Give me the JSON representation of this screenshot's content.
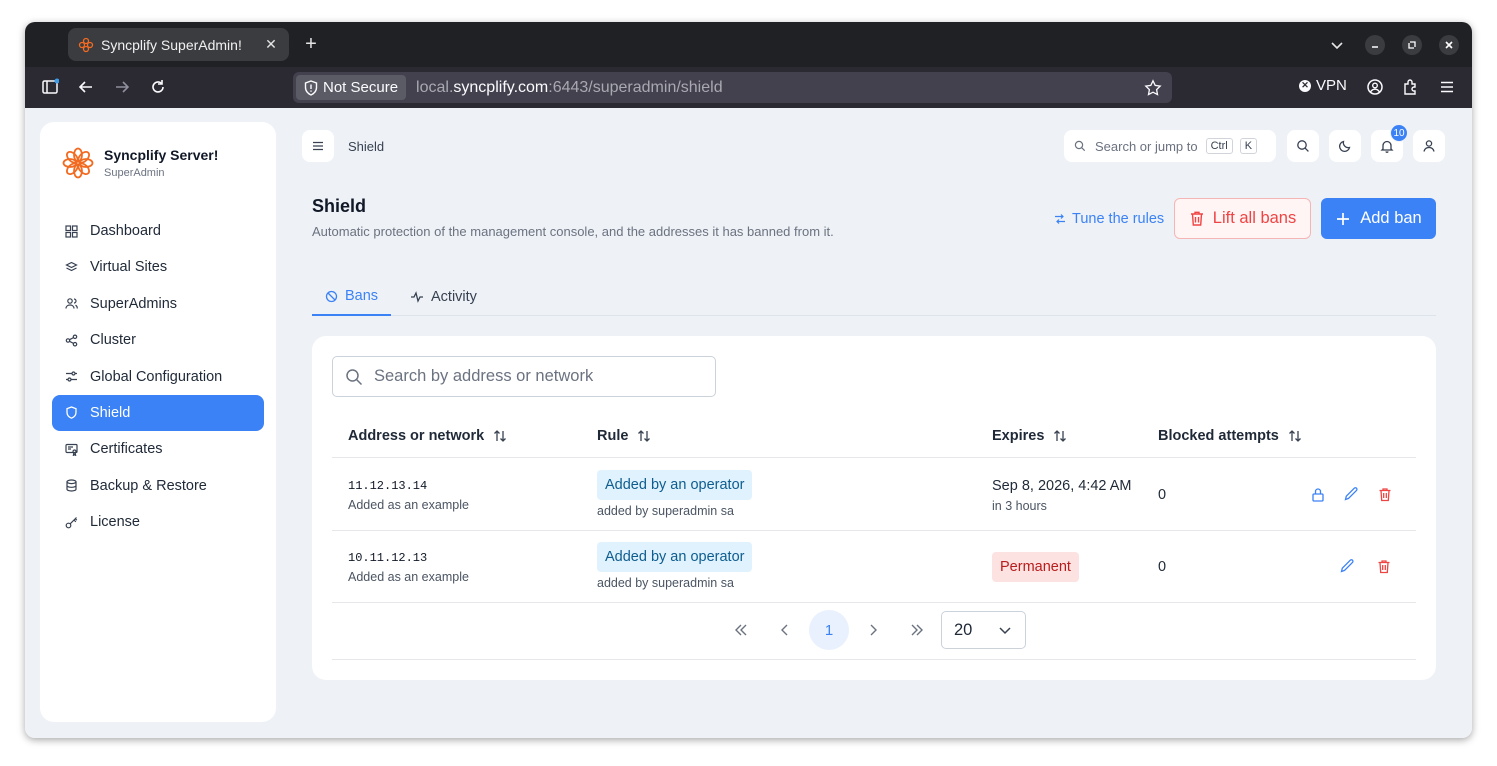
{
  "browser": {
    "tab_title": "Syncplify SuperAdmin!",
    "not_secure_label": "Not Secure",
    "url_prefix": "local.",
    "url_host": "syncplify.com",
    "url_rest": ":6443/superadmin/shield",
    "vpn_label": "VPN"
  },
  "sidebar": {
    "brand_name": "Syncplify Server!",
    "brand_sub": "SuperAdmin",
    "items": [
      {
        "label": "Dashboard",
        "icon": "grid-icon"
      },
      {
        "label": "Virtual Sites",
        "icon": "layers-icon"
      },
      {
        "label": "SuperAdmins",
        "icon": "users-icon"
      },
      {
        "label": "Cluster",
        "icon": "share-icon"
      },
      {
        "label": "Global Configuration",
        "icon": "sliders-icon"
      },
      {
        "label": "Shield",
        "icon": "shield-icon"
      },
      {
        "label": "Certificates",
        "icon": "certificate-icon"
      },
      {
        "label": "Backup & Restore",
        "icon": "database-icon"
      },
      {
        "label": "License",
        "icon": "key-icon"
      }
    ],
    "active": "Shield"
  },
  "header": {
    "breadcrumb": "Shield",
    "search_placeholder": "Search or jump to",
    "kbd1": "Ctrl",
    "kbd2": "K",
    "notifications_count": "10"
  },
  "page": {
    "title": "Shield",
    "subtitle": "Automatic protection of the management console, and the addresses it has banned from it.",
    "tune_label": "Tune the rules",
    "lift_label": "Lift all bans",
    "add_label": "Add ban",
    "tabs": [
      {
        "label": "Bans",
        "active": true
      },
      {
        "label": "Activity",
        "active": false
      }
    ]
  },
  "table": {
    "search_placeholder": "Search by address or network",
    "columns": [
      "Address or network",
      "Rule",
      "Expires",
      "Blocked attempts"
    ],
    "rows": [
      {
        "address": "11.12.13.14",
        "address_note": "Added as an example",
        "rule": "Added by an operator",
        "rule_note": "added by superadmin sa",
        "expires": "Sep 8, 2026, 4:42 AM",
        "expires_note": "in 3 hours",
        "blocked": "0"
      },
      {
        "address": "10.11.12.13",
        "address_note": "Added as an example",
        "rule": "Added by an operator",
        "rule_note": "added by superadmin sa",
        "expires": "Permanent",
        "expires_note": "",
        "blocked": "0"
      }
    ],
    "pager": {
      "current_page": "1",
      "page_size": "20"
    }
  },
  "colors": {
    "accent": "#3b82f6",
    "danger": "#ef4444",
    "brand_orange": "#f26b21"
  }
}
